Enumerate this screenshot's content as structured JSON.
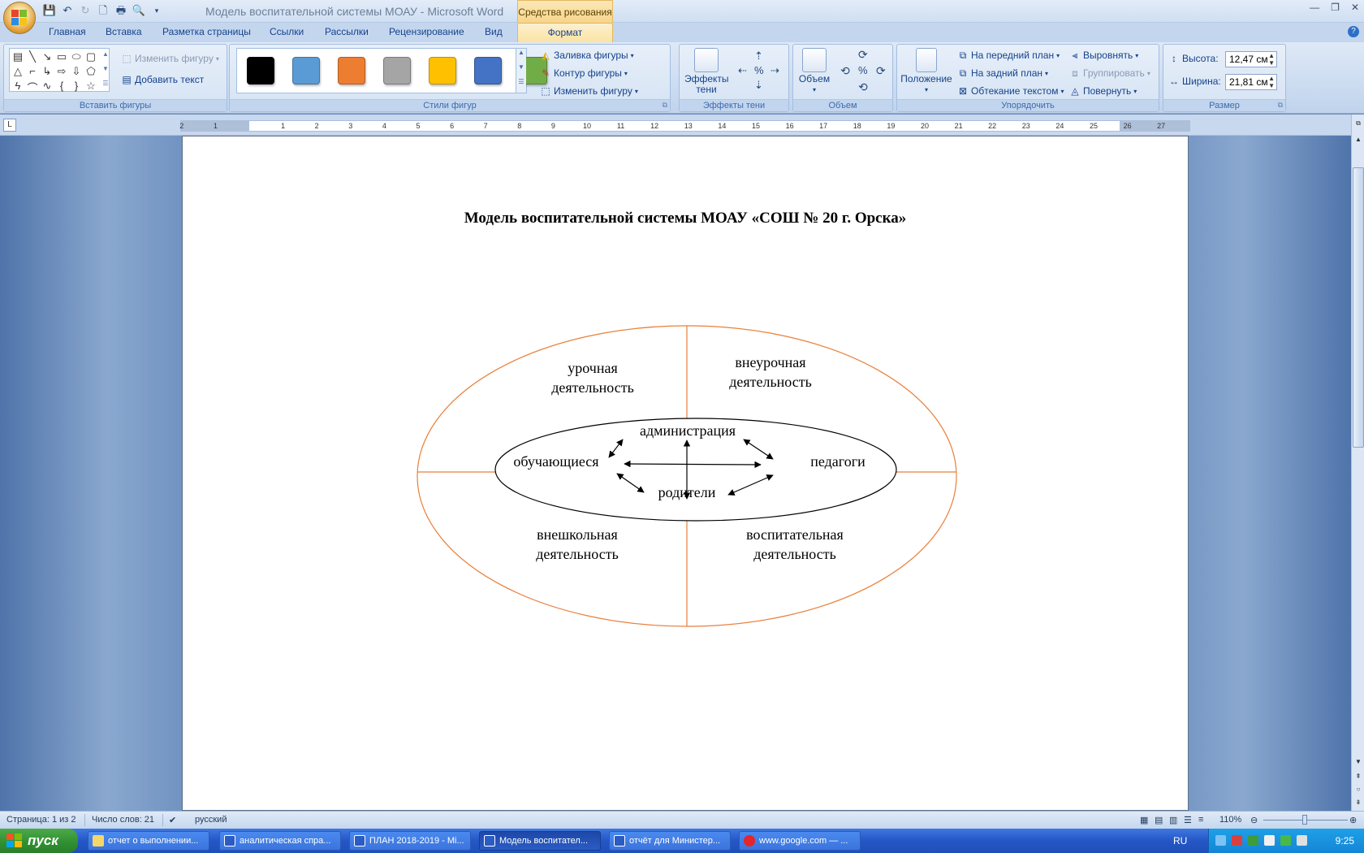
{
  "window": {
    "title": "Модель воспитательной системы МОАУ - Microsoft Word",
    "context_tab_title": "Средства рисования"
  },
  "tabs": [
    "Главная",
    "Вставка",
    "Разметка страницы",
    "Ссылки",
    "Рассылки",
    "Рецензирование",
    "Вид",
    "Формат"
  ],
  "ribbon": {
    "insert_shapes": {
      "label": "Вставить фигуры",
      "edit_shape": "Изменить фигуру",
      "add_text": "Добавить текст"
    },
    "shape_styles": {
      "label": "Стили фигур",
      "fill": "Заливка фигуры",
      "outline": "Контур фигуры",
      "change": "Изменить фигуру",
      "swatches": [
        "#000000",
        "#5b9bd5",
        "#ed7d31",
        "#a5a5a5",
        "#ffc000",
        "#4472c4",
        "#70ad47"
      ]
    },
    "shadow": {
      "label": "Эффекты тени",
      "button": "Эффекты тени"
    },
    "volume": {
      "label": "Объем",
      "button": "Объем"
    },
    "arrange": {
      "label": "Упорядочить",
      "position": "Положение",
      "bring_front": "На передний план",
      "send_back": "На задний план",
      "wrap": "Обтекание текстом",
      "align": "Выровнять",
      "group": "Группировать",
      "rotate": "Повернуть"
    },
    "size": {
      "label": "Размер",
      "height_label": "Высота:",
      "height_value": "12,47 см",
      "width_label": "Ширина:",
      "width_value": "21,81 см"
    }
  },
  "ruler": {
    "left_numbers": [
      "2",
      "1"
    ],
    "right_numbers": [
      "1",
      "2",
      "3",
      "4",
      "5",
      "6",
      "7",
      "8",
      "9",
      "10",
      "11",
      "12",
      "13",
      "14",
      "15",
      "16",
      "17",
      "18",
      "19",
      "20",
      "21",
      "22",
      "23",
      "24",
      "25",
      "26",
      "27"
    ]
  },
  "document": {
    "title": "Модель воспитательной системы МОАУ «СОШ № 20 г. Орска»",
    "diagram": {
      "quadrants": {
        "top_left": [
          "урочная",
          "деятельность"
        ],
        "top_right": [
          "внеурочная",
          "деятельность"
        ],
        "bottom_left": [
          "внешкольная",
          "деятельность"
        ],
        "bottom_right": [
          "воспитательная",
          "деятельность"
        ]
      },
      "center": {
        "top": "администрация",
        "left": "обучающиеся",
        "right": "педагоги",
        "bottom": "родители"
      },
      "outer_color": "#e97f3a",
      "inner_color": "#000000"
    }
  },
  "status": {
    "page": "Страница: 1 из 2",
    "words": "Число слов: 21",
    "language": "русский",
    "zoom": "110%"
  },
  "taskbar": {
    "start": "пуск",
    "tasks": [
      "отчет о выполнении...",
      "аналитическая спра...",
      "ПЛАН 2018-2019 - Mi...",
      "Модель воспитател...",
      "отчёт для Министер...",
      "www.google.com — ..."
    ],
    "lang": "RU",
    "clock": "9:25"
  }
}
